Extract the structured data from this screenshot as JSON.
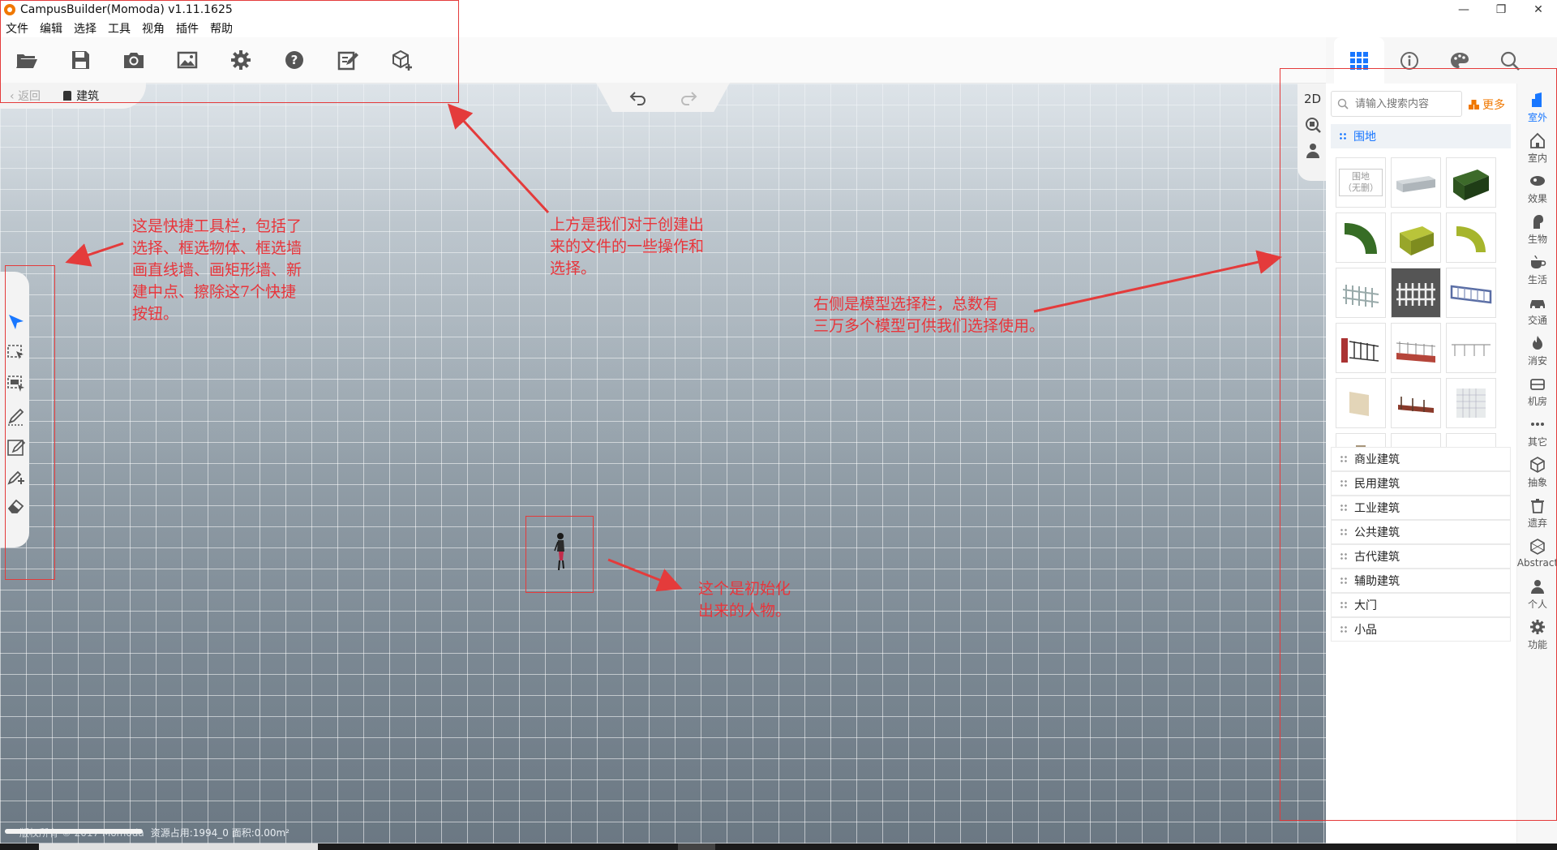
{
  "window": {
    "title": "CampusBuilder(Momoda) v1.11.1625",
    "controls": {
      "minimize": "—",
      "maximize": "❐",
      "close": "✕"
    }
  },
  "menu": [
    "文件",
    "编辑",
    "选择",
    "工具",
    "视角",
    "插件",
    "帮助"
  ],
  "toolbar": {
    "icons": [
      "folder-open-icon",
      "save-icon",
      "camera-icon",
      "image-icon",
      "settings-gear-icon",
      "help-icon",
      "edit-note-icon",
      "add-cube-icon"
    ]
  },
  "breadcrumb": {
    "back": "返回",
    "current": "建筑"
  },
  "view_tools": {
    "mode_2d": "2D"
  },
  "panel": {
    "search_placeholder": "请输入搜索内容",
    "more": "更多",
    "active_category": "围地",
    "none_tile": "围地\n（无删）",
    "categories": [
      "商业建筑",
      "民用建筑",
      "工业建筑",
      "公共建筑",
      "古代建筑",
      "辅助建筑",
      "大门",
      "小品"
    ]
  },
  "rail": [
    {
      "label": "室外",
      "icon": "outdoor-building-icon"
    },
    {
      "label": "室内",
      "icon": "home-icon"
    },
    {
      "label": "效果",
      "icon": "effect-icon"
    },
    {
      "label": "生物",
      "icon": "creature-icon"
    },
    {
      "label": "生活",
      "icon": "coffee-cup-icon"
    },
    {
      "label": "交通",
      "icon": "car-icon"
    },
    {
      "label": "消安",
      "icon": "fire-icon"
    },
    {
      "label": "机房",
      "icon": "server-icon"
    },
    {
      "label": "其它",
      "icon": "more-dots-icon"
    },
    {
      "label": "抽象",
      "icon": "abstract-cube-icon"
    },
    {
      "label": "遗弃",
      "icon": "trash-icon"
    },
    {
      "label": "Abstract",
      "icon": "abstract-box-icon"
    },
    {
      "label": "个人",
      "icon": "person-icon"
    },
    {
      "label": "功能",
      "icon": "function-gear-icon"
    }
  ],
  "status": {
    "left": "版权所有 © 2017 Momoda",
    "right": "资源占用:1994_0   面积:0.00m²",
    "progress": 1.0
  },
  "annotations": {
    "left_toolbar": "这是快捷工具栏，包括了\n选择、框选物体、框选墙\n画直线墙、画矩形墙、新\n建中点、擦除这7个快捷\n按钮。",
    "top": "上方是我们对于创建出\n来的文件的一些操作和\n选择。",
    "right": "右侧是模型选择栏，总数有\n三万多个模型可供我们选择使用。",
    "person": "这个是初始化\n出来的人物。"
  }
}
